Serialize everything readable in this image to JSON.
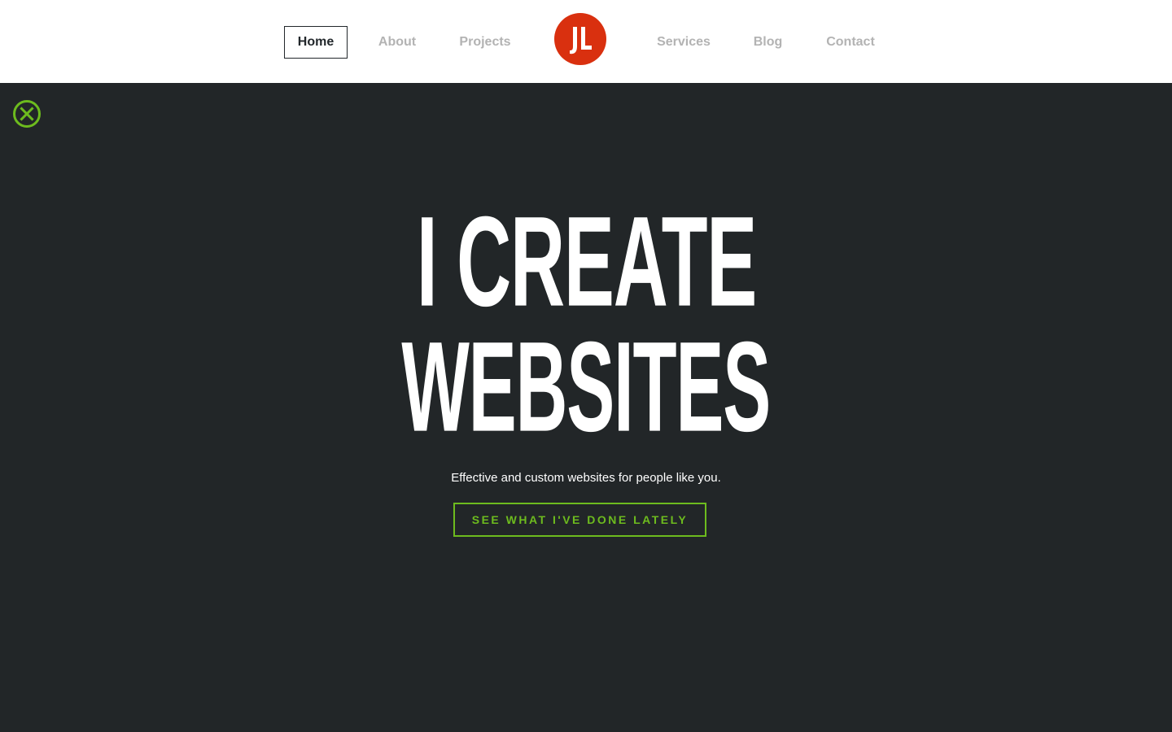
{
  "nav": {
    "items": [
      {
        "label": "Home",
        "active": true
      },
      {
        "label": "About",
        "active": false
      },
      {
        "label": "Projects",
        "active": false
      },
      {
        "label": "Services",
        "active": false
      },
      {
        "label": "Blog",
        "active": false
      },
      {
        "label": "Contact",
        "active": false
      }
    ],
    "logo_text": "JL"
  },
  "hero": {
    "headline_line1": "I CREATE",
    "headline_line2": "WEBSITES",
    "tagline": "Effective and custom websites for people like you.",
    "cta_label": "SEE WHAT I'VE DONE LATELY",
    "close_icon": "close-circle-icon"
  },
  "colors": {
    "background_dark": "#222628",
    "accent_green": "#6dbb1e",
    "logo_red": "#d9300f",
    "nav_inactive": "#b3b3b3",
    "nav_active": "#22272b"
  }
}
